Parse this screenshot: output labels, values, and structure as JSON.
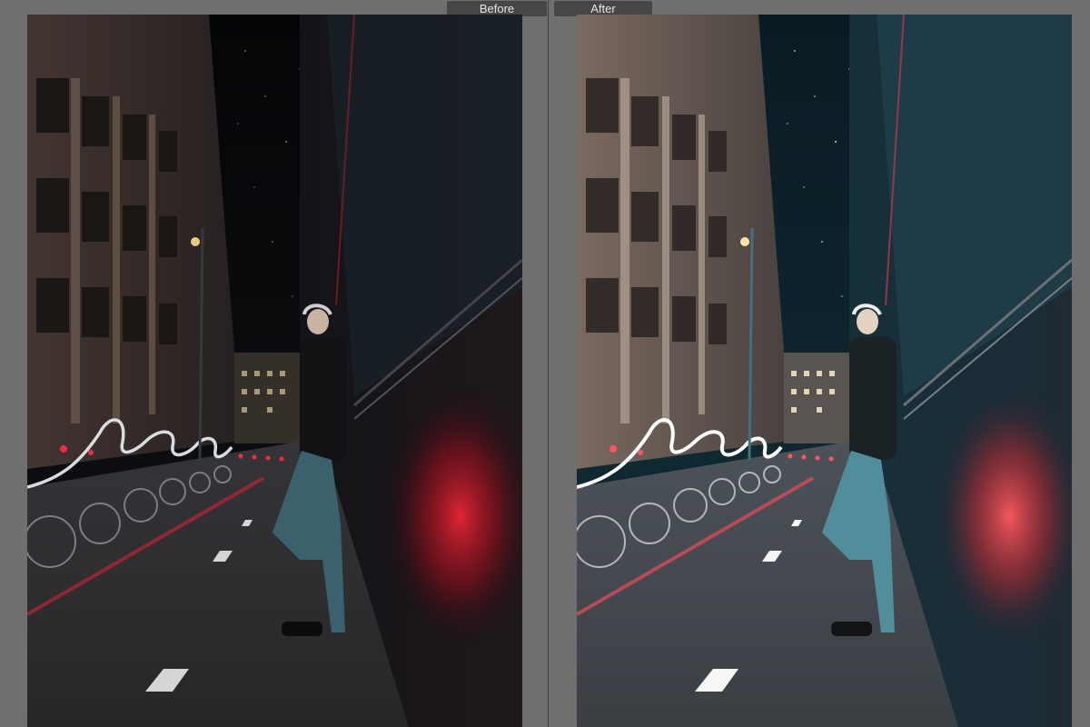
{
  "compare": {
    "before_label": "Before",
    "after_label": "After"
  },
  "colors": {
    "frame": "#787878",
    "label_bg": "#464646",
    "label_text": "#e6e6e6",
    "accent_red": "#ff3344",
    "neon_white": "#f4fbff",
    "teal_shadow": "#17353d"
  }
}
